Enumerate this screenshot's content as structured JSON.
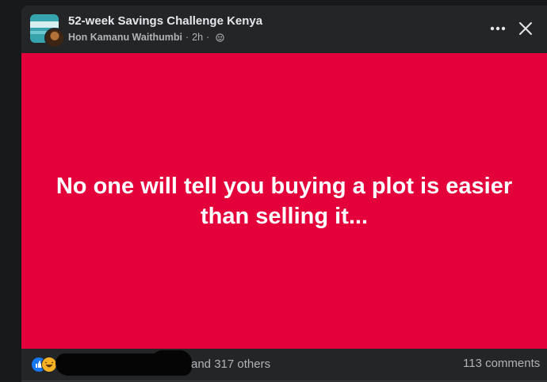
{
  "post": {
    "group_name": "52-week Savings Challenge Kenya",
    "author": "Hon Kamanu Waithumbi",
    "time": "2h",
    "separator": "·",
    "body_text": "No one will tell you buying a plot is easier than selling it...",
    "background_color": "#e4003b"
  },
  "reactions": {
    "icons": [
      "like-icon",
      "haha-icon"
    ],
    "others_text": "and 317 others",
    "comments_text": "113 comments"
  },
  "header_icons": {
    "more": "more-horizontal-icon",
    "close": "close-icon",
    "privacy": "globe-icon"
  }
}
